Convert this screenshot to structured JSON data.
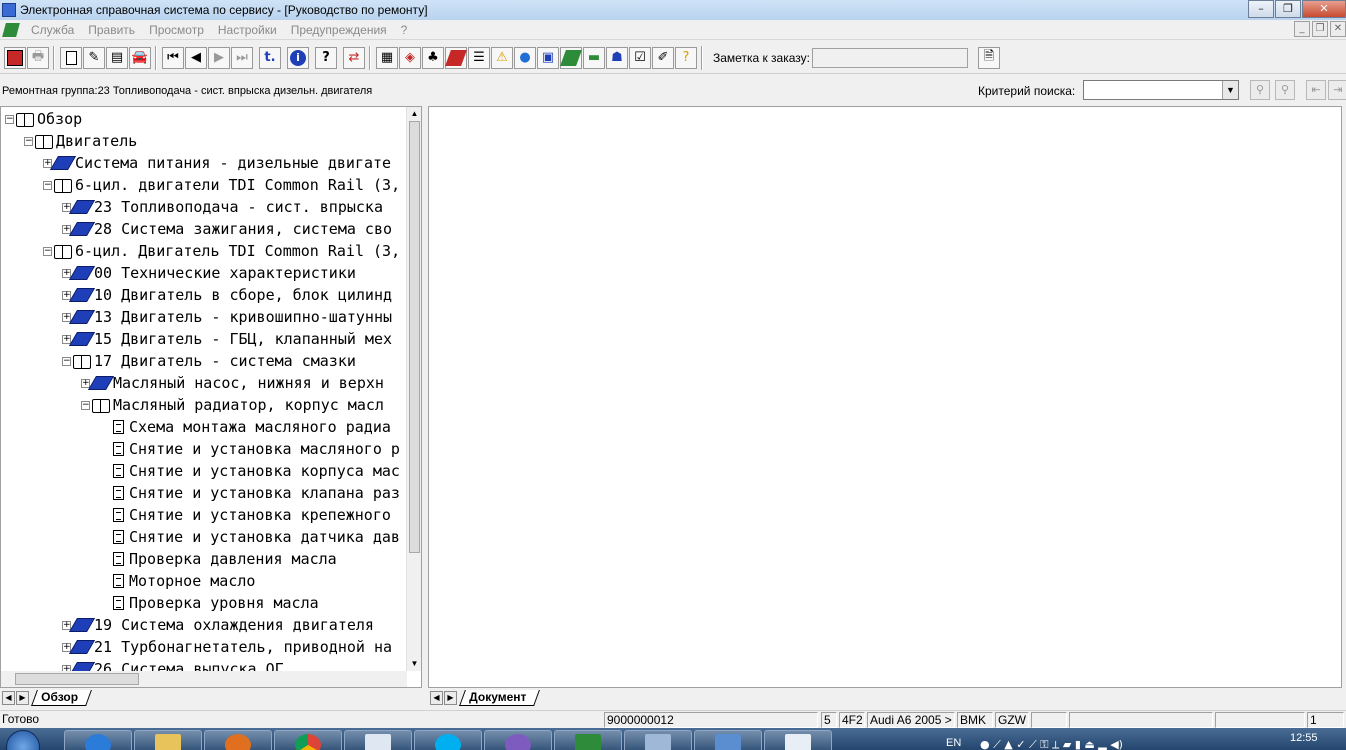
{
  "window": {
    "title": "Электронная справочная система по сервису - [Руководство по ремонту]"
  },
  "menu": [
    "Служба",
    "Править",
    "Просмотр",
    "Настройки",
    "Предупреждения",
    "?"
  ],
  "toolbar": {
    "note_label": "Заметка к заказу:",
    "note_value": ""
  },
  "info": {
    "repair_group": "Ремонтная группа:23 Топливоподача - сист. впрыска дизельн. двигателя",
    "search_label": "Критерий  поиска:",
    "search_value": ""
  },
  "tree": {
    "nodes": [
      {
        "text": "Обзор",
        "level": 0,
        "kind": "open",
        "expander": "−"
      },
      {
        "text": "Двигатель",
        "level": 1,
        "kind": "open",
        "expander": "−"
      },
      {
        "text": "Система питания - дизельные двигате",
        "level": 2,
        "kind": "closed",
        "expander": "+"
      },
      {
        "text": "6-цил. двигатели TDI Common Rail (3,",
        "level": 2,
        "kind": "open",
        "expander": "−"
      },
      {
        "text": "23 Топливоподача - сист. впрыска",
        "level": 3,
        "kind": "closed",
        "expander": "+"
      },
      {
        "text": "28 Система зажигания, система сво",
        "level": 3,
        "kind": "closed",
        "expander": "+"
      },
      {
        "text": "6-цил. Двигатель TDI Common Rail (3,",
        "level": 2,
        "kind": "open",
        "expander": "−"
      },
      {
        "text": "00 Технические характеристики",
        "level": 3,
        "kind": "closed",
        "expander": "+"
      },
      {
        "text": "10 Двигатель в сборе, блок цилинд",
        "level": 3,
        "kind": "closed",
        "expander": "+"
      },
      {
        "text": "13 Двигатель - кривошипно-шатунны",
        "level": 3,
        "kind": "closed",
        "expander": "+"
      },
      {
        "text": "15 Двигатель - ГБЦ, клапанный мех",
        "level": 3,
        "kind": "closed",
        "expander": "+"
      },
      {
        "text": "17 Двигатель - система смазки",
        "level": 3,
        "kind": "open",
        "expander": "−"
      },
      {
        "text": "Масляный насос, нижняя и верхн",
        "level": 4,
        "kind": "closed",
        "expander": "+"
      },
      {
        "text": "Масляный радиатор, корпус масл",
        "level": 4,
        "kind": "open",
        "expander": "−"
      },
      {
        "text": "Схема монтажа масляного радиа",
        "level": 5,
        "kind": "page",
        "expander": ""
      },
      {
        "text": "Снятие и установка масляного р",
        "level": 5,
        "kind": "page",
        "expander": ""
      },
      {
        "text": "Снятие и установка корпуса мас",
        "level": 5,
        "kind": "page",
        "expander": ""
      },
      {
        "text": "Снятие и установка клапана раз",
        "level": 5,
        "kind": "page",
        "expander": ""
      },
      {
        "text": "Снятие и установка крепежного",
        "level": 5,
        "kind": "page",
        "expander": ""
      },
      {
        "text": "Снятие и установка датчика дав",
        "level": 5,
        "kind": "page",
        "expander": ""
      },
      {
        "text": "Проверка давления масла",
        "level": 5,
        "kind": "page",
        "expander": ""
      },
      {
        "text": "Моторное масло",
        "level": 5,
        "kind": "page",
        "expander": ""
      },
      {
        "text": "Проверка уровня масла",
        "level": 5,
        "kind": "page",
        "expander": ""
      },
      {
        "text": "19 Система охлаждения двигателя",
        "level": 3,
        "kind": "closed",
        "expander": "+"
      },
      {
        "text": "21 Турбонагнетатель, приводной на",
        "level": 3,
        "kind": "closed",
        "expander": "+"
      },
      {
        "text": "26 Система выпуска ОГ",
        "level": 3,
        "kind": "closed",
        "expander": "+"
      }
    ]
  },
  "tabs": {
    "left": "Обзор",
    "right": "Документ"
  },
  "status": {
    "ready": "Готово",
    "number": "9000000012",
    "field1": "5",
    "field2": "4F2",
    "model": "Audi A6 2005 >",
    "engine": "BMK",
    "gearbox": "GZW",
    "page": "1"
  },
  "taskbar": {
    "lang": "EN",
    "time": "12:55"
  }
}
